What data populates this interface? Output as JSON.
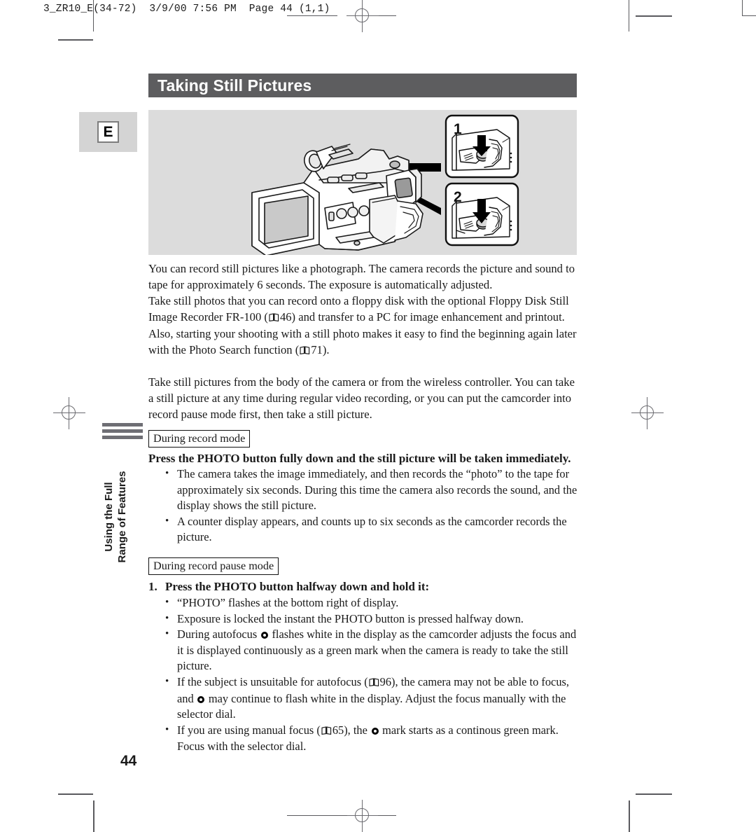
{
  "slug": "3_ZR10_E(34-72)  3/9/00 7:56 PM  Page 44 (1,1)",
  "header": {
    "title": "Taking Still Pictures"
  },
  "language_chip": {
    "label": "E"
  },
  "illustration": {
    "alt": "camcorder-with-open-lcd-and-two-photo-button-callouts",
    "callouts": [
      {
        "number": "1",
        "alt": "finger-pressing-photo-button-halfway"
      },
      {
        "number": "2",
        "alt": "finger-pressing-photo-button-fully"
      }
    ]
  },
  "body": {
    "p1": "You can record still pictures like a photograph. The camera records the picture and sound to tape for approximately 6 seconds. The exposure is automatically adjusted.",
    "p2_a": "Take still photos that you can record onto a floppy disk with the optional Floppy Disk Still Image Recorder FR-100 (",
    "p2_ref1": "46) and transfer to a PC for image enhancement and printout. Also, starting your shooting with a still photo makes it easy to find the beginning again later with the Photo Search function (",
    "p2_ref2": "71).",
    "p3": "Take still pictures from the body of the camera or from the wireless controller. You can take a still picture at any time during regular video recording, or you can put the camcorder into record pause mode first, then take a still picture."
  },
  "section_record_mode": {
    "box_label": "During record mode",
    "heading": "Press the PHOTO button fully down and the still picture will be taken immediately.",
    "bullets": [
      "The camera takes the image immediately, and then records the “photo” to the tape for approximately six seconds. During this time the camera also records the sound, and the display shows the still picture.",
      "A counter display appears, and counts up to six seconds as the camcorder records the picture."
    ]
  },
  "section_record_pause_mode": {
    "box_label": "During record pause mode",
    "step_number": "1.",
    "heading": "Press the PHOTO button halfway down and hold it:",
    "bullets": [
      {
        "before": "“PHOTO” flashes at the bottom right of display.",
        "after": "",
        "after2": ""
      },
      {
        "before": "Exposure is locked the instant the PHOTO button is pressed halfway down.",
        "after": "",
        "after2": ""
      },
      {
        "before": "During autofocus ",
        "after": " flashes white in the display as the camcorder adjusts the focus and it is displayed continuously as a green mark when the camera is ready to take the still picture.",
        "after2": ""
      },
      {
        "before": "If the subject is unsuitable for autofocus (",
        "ref": "96), the camera may not be able to focus, and ",
        "after": " may continue to flash white in the display. Adjust the focus manually with the selector dial.",
        "after2": ""
      },
      {
        "before": "If you are using manual focus (",
        "ref": "65), the ",
        "after": " mark starts as a continous green mark. Focus with the selector dial.",
        "after2": ""
      }
    ]
  },
  "side_tab": {
    "line1": "Using the Full",
    "line2": "Range of Features"
  },
  "footer": {
    "page_number": "44"
  },
  "colors": {
    "title_bar_bg": "#5d5d5f",
    "illustration_bg": "#dcdcdc",
    "chip_bg": "#d4d4d4",
    "side_bar": "#6e6e74",
    "text": "#1a1a1a"
  }
}
